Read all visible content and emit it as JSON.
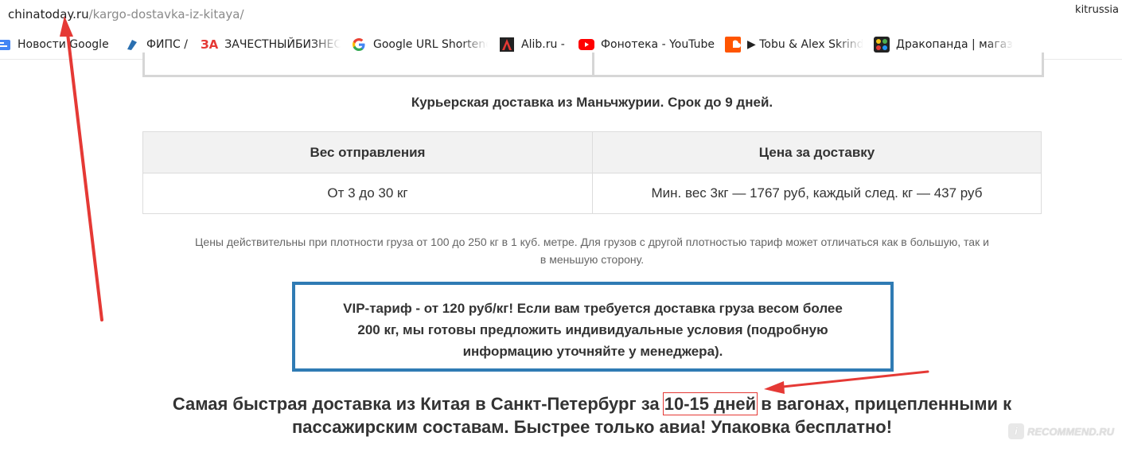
{
  "browser": {
    "url_host": "chinatoday.ru",
    "url_path": "/kargo-dostavka-iz-kitaya/",
    "profile_name": "kitrussia"
  },
  "bookmarks": [
    {
      "label": "Новости Google",
      "icon": "google-news-icon"
    },
    {
      "label": "ФИПС /",
      "icon": "fips-icon"
    },
    {
      "label": "ЗАЧЕСТНЫЙБИЗНЕС",
      "icon": "za-icon",
      "icon_text": "ЗА"
    },
    {
      "label": "Google URL Shortener",
      "icon": "google-icon"
    },
    {
      "label": "Alib.ru -",
      "icon": "alib-icon"
    },
    {
      "label": "Фонотека - YouTube",
      "icon": "youtube-icon"
    },
    {
      "label": "▶ Tobu & Alex Skrindo",
      "icon": "soundcloud-icon"
    },
    {
      "label": "Дракопанда | магазин",
      "icon": "drakopanda-icon"
    }
  ],
  "content": {
    "heading": "Курьерская доставка из Маньчжурии. Срок до 9 дней.",
    "table": {
      "headers": [
        "Вес отправления",
        "Цена за доставку"
      ],
      "rows": [
        [
          "От 3 до 30 кг",
          "Мин. вес 3кг — 1767 руб, каждый след. кг — 437 руб"
        ]
      ]
    },
    "note_line1": "Цены действительны при плотности груза от 100 до 250 кг в 1 куб. метре. Для грузов с другой плотностью тариф может отличаться как в большую, так и",
    "note_line2": "в меньшую сторону.",
    "vip": {
      "line1": "VIP-тариф - от 120 руб/кг! Если вам требуется доставка груза весом более",
      "line2": "200 кг, мы готовы предложить индивидуальные условия (подробную",
      "line3": "информацию уточняйте у менеджера)."
    },
    "promo": {
      "before": "Самая быстрая доставка из Китая в Санкт-Петербург за ",
      "highlight": "10-15 дней",
      "after": " в вагонах, прицепленными к",
      "line2": "пассажирским составам. Быстрее только авиа! Упаковка бесплатно!"
    }
  },
  "watermark": {
    "text": "RECOMMEND.RU"
  },
  "colors": {
    "vip_border": "#2f7bb4",
    "annotation_arrow": "#e53935",
    "table_header_bg": "#f2f2f2"
  }
}
